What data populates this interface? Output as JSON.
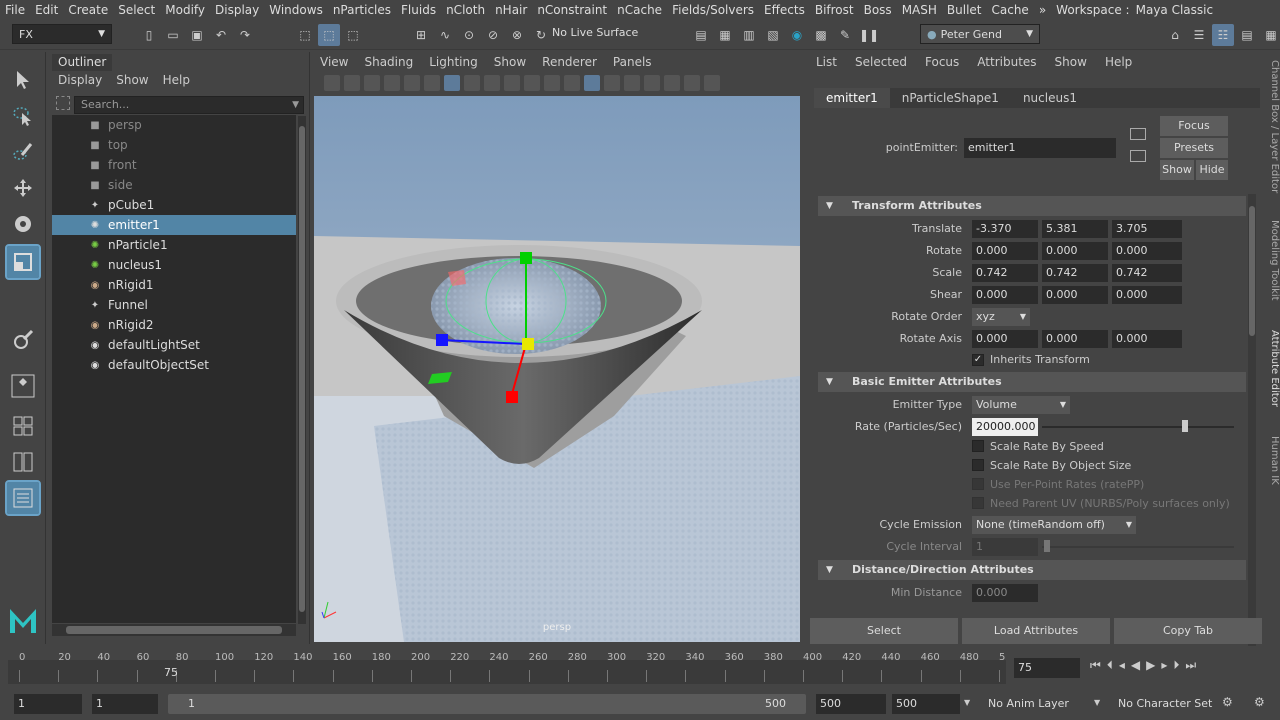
{
  "menubar": {
    "items": [
      "File",
      "Edit",
      "Create",
      "Select",
      "Modify",
      "Display",
      "Windows",
      "nParticles",
      "Fluids",
      "nCloth",
      "nHair",
      "nConstraint",
      "nCache",
      "Fields/Solvers",
      "Effects",
      "Bifrost",
      "Boss",
      "MASH",
      "Bullet",
      "Cache"
    ],
    "workspace_label": "Workspace :",
    "workspace_value": "Maya Classic"
  },
  "toolbar": {
    "menuset": "FX",
    "live_surface": "No Live Surface",
    "user": "Peter Gend"
  },
  "outliner": {
    "title": "Outliner",
    "menus": [
      "Display",
      "Show",
      "Help"
    ],
    "search_placeholder": "Search...",
    "items": [
      {
        "label": "persp",
        "icon": "camera-icon",
        "dim": true
      },
      {
        "label": "top",
        "icon": "camera-icon",
        "dim": true
      },
      {
        "label": "front",
        "icon": "camera-icon",
        "dim": true
      },
      {
        "label": "side",
        "icon": "camera-icon",
        "dim": true
      },
      {
        "label": "pCube1",
        "icon": "mesh-icon",
        "dim": false
      },
      {
        "label": "emitter1",
        "icon": "emitter-icon",
        "dim": false,
        "selected": true
      },
      {
        "label": "nParticle1",
        "icon": "particle-icon",
        "dim": false
      },
      {
        "label": "nucleus1",
        "icon": "nucleus-icon",
        "dim": false
      },
      {
        "label": "nRigid1",
        "icon": "rigid-icon",
        "dim": false
      },
      {
        "label": "Funnel",
        "icon": "mesh-icon",
        "dim": false
      },
      {
        "label": "nRigid2",
        "icon": "rigid-icon",
        "dim": false
      },
      {
        "label": "defaultLightSet",
        "icon": "set-icon",
        "dim": false
      },
      {
        "label": "defaultObjectSet",
        "icon": "set-icon",
        "dim": false
      }
    ]
  },
  "viewport": {
    "menus": [
      "View",
      "Shading",
      "Lighting",
      "Show",
      "Renderer",
      "Panels"
    ],
    "camera_label": "persp"
  },
  "ae": {
    "menus": [
      "List",
      "Selected",
      "Focus",
      "Attributes",
      "Show",
      "Help"
    ],
    "tabs": [
      "emitter1",
      "nParticleShape1",
      "nucleus1"
    ],
    "node_type_label": "pointEmitter:",
    "node_name": "emitter1",
    "focus": "Focus",
    "presets": "Presets",
    "show": "Show",
    "hide": "Hide",
    "transform": {
      "title": "Transform Attributes",
      "translate_label": "Translate",
      "translate": [
        "-3.370",
        "5.381",
        "3.705"
      ],
      "rotate_label": "Rotate",
      "rotate": [
        "0.000",
        "0.000",
        "0.000"
      ],
      "scale_label": "Scale",
      "scale": [
        "0.742",
        "0.742",
        "0.742"
      ],
      "shear_label": "Shear",
      "shear": [
        "0.000",
        "0.000",
        "0.000"
      ],
      "rotate_order_label": "Rotate Order",
      "rotate_order": "xyz",
      "rotate_axis_label": "Rotate Axis",
      "rotate_axis": [
        "0.000",
        "0.000",
        "0.000"
      ],
      "inherits": "Inherits Transform"
    },
    "emitter": {
      "title": "Basic Emitter Attributes",
      "type_label": "Emitter Type",
      "type": "Volume",
      "rate_label": "Rate (Particles/Sec)",
      "rate": "20000.000",
      "rate_slider": 0.73,
      "opts": [
        "Scale Rate By Speed",
        "Scale Rate By Object Size",
        "Use Per-Point Rates (ratePP)",
        "Need Parent UV (NURBS/Poly surfaces only)"
      ],
      "cycle_label": "Cycle Emission",
      "cycle": "None (timeRandom off)",
      "interval_label": "Cycle Interval",
      "interval": "1"
    },
    "distance": {
      "title": "Distance/Direction Attributes",
      "min_label": "Min Distance",
      "min": "0.000"
    },
    "select_btn": "Select",
    "load_btn": "Load Attributes",
    "copy_btn": "Copy Tab"
  },
  "side_tabs": [
    "Channel Box / Layer Editor",
    "Modeling Toolkit",
    "Attribute Editor",
    "Human IK"
  ],
  "timeline": {
    "ticks": [
      "0",
      "20",
      "40",
      "60",
      "80",
      "100",
      "120",
      "140",
      "160",
      "180",
      "200",
      "220",
      "240",
      "260",
      "280",
      "300",
      "320",
      "340",
      "360",
      "380",
      "400",
      "420",
      "440",
      "460",
      "480",
      "5"
    ],
    "current": "75",
    "current_frame": "75"
  },
  "range": {
    "start": "1",
    "playback_start": "1",
    "slider_start": "1",
    "slider_end": "500",
    "playback_end": "500",
    "end": "500",
    "anim_layer": "No Anim Layer",
    "char_set": "No Character Set"
  }
}
